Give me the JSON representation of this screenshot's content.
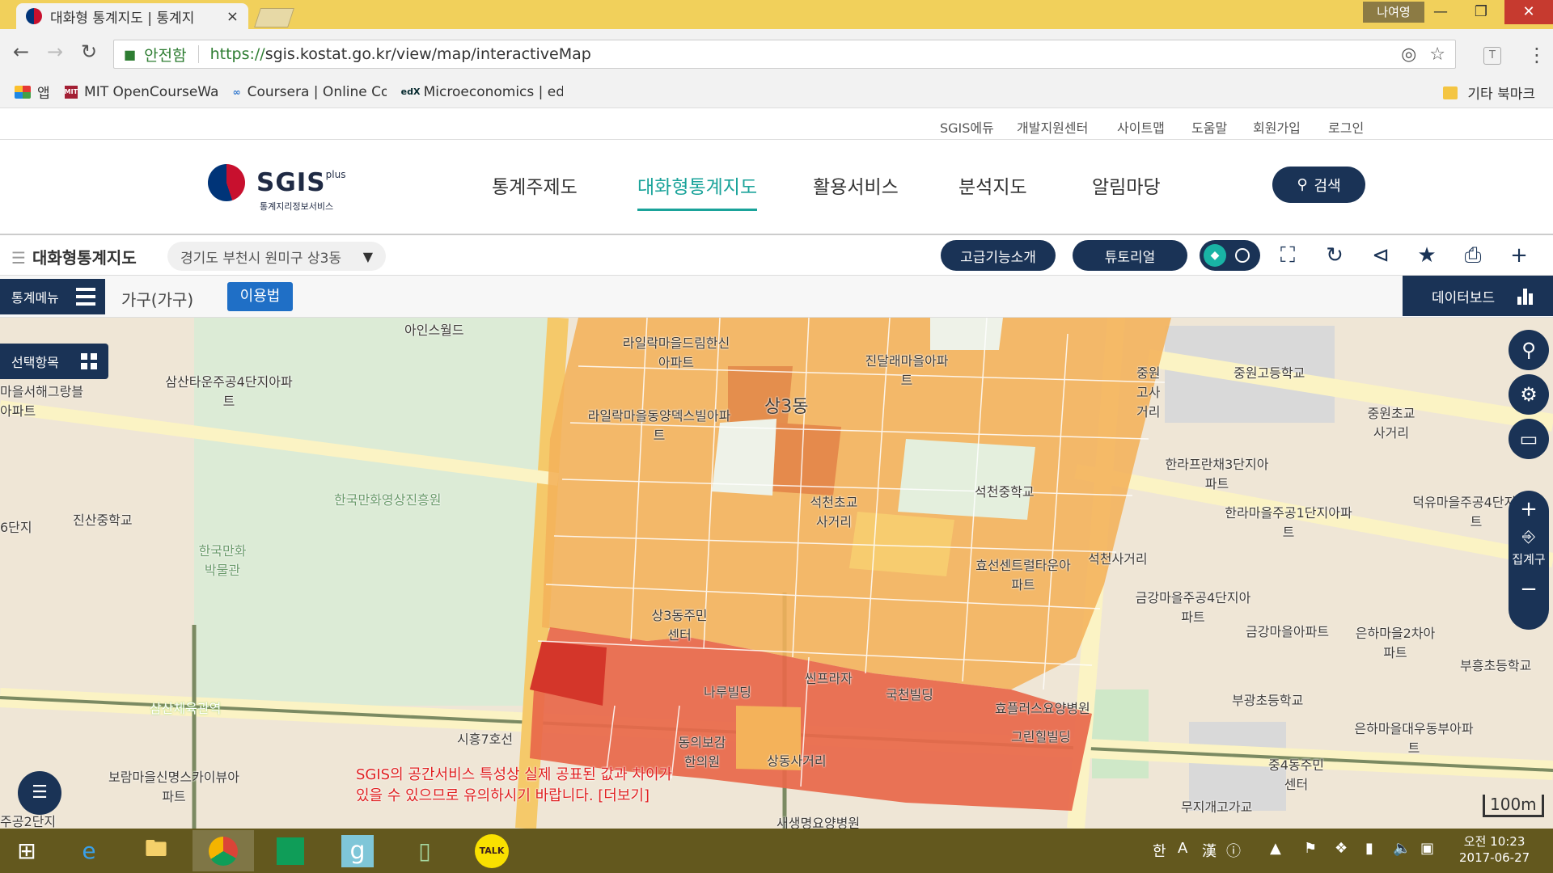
{
  "browser": {
    "tab_title": "대화형 통계지도 | 통계지",
    "tab_close": "×",
    "user": "나여영",
    "win_min": "—",
    "win_max": "❐",
    "win_close": "✕",
    "back": "←",
    "forward": "→",
    "reload": "↻",
    "secure_label": "안전함",
    "url_scheme": "https://",
    "url_rest": "sgis.kostat.go.kr/view/map/interactiveMap",
    "ext_label": "T",
    "bookmarks": [
      {
        "icon": "apps-icon",
        "label": "앱"
      },
      {
        "icon": "mit-icon",
        "label": "MIT OpenCourseWar"
      },
      {
        "icon": "coursera-icon",
        "label": "Coursera | Online Co"
      },
      {
        "icon": "edx-icon",
        "label": "Microeconomics | ed"
      }
    ],
    "other_bookmarks": "기타 북마크"
  },
  "site": {
    "util_links": [
      "SGIS에듀",
      "개발지원센터",
      "사이트맵",
      "도움말",
      "회원가입",
      "로그인"
    ],
    "logo_text": "SGIS",
    "logo_sup": "plus",
    "logo_sub": "통계지리정보서비스",
    "gnb": [
      "통계주제도",
      "대화형통계지도",
      "활용서비스",
      "분석지도",
      "알림마당"
    ],
    "search_label": "검색",
    "toolbar_title": "대화형통계지도",
    "region": "경기도 부천시 원미구 상3동",
    "advanced_btn": "고급기능소개",
    "tutorial_btn": "튜토리얼",
    "stat_menu": "통계메뉴",
    "sub_item": "가구(가구)",
    "usage_btn": "이용법",
    "databoard": "데이터보드",
    "select_items": "선택항목",
    "aggregate": "집계구",
    "notice_line1": "SGIS의 공간서비스 특성상 실제 공표된 값과 차이가",
    "notice_line2": "있을 수 있으므로 유의하시기 바랍니다. [더보기]",
    "scale": "100m"
  },
  "map_labels": [
    "아인스월드",
    "라일락마을드림한신아파트",
    "진달래마을아파트",
    "중원고사거리",
    "중원고등학교",
    "삼산타운주공4단지아파트",
    "마을서해그랑블아파트",
    "라일락마을동양덱스빌아파트",
    "상3동",
    "중원초교사거리",
    "석천초교사거리",
    "석천중학교",
    "한라프란채3단지아파트",
    "한라마을주공1단지아파트",
    "덕유마을주공4단지아파트",
    "한국만화영상진흥원",
    "진산중학교",
    "6단지",
    "한국만화박물관",
    "효선센트럴타운아파트",
    "금강마을주공4단지아파트",
    "금강마을아파트",
    "은하마을2차아파트",
    "부흥초등학교",
    "상3동주민센터",
    "씬프라자",
    "국천빌딩",
    "효플러스요양병원",
    "나루빌딩",
    "그린힐빌딩",
    "동의보감한의원",
    "부광초등학교",
    "중4동주민센터",
    "은하마을대우동부아파트",
    "삼산체육관역",
    "보람마을신명스카이뷰아파트",
    "주공2단지",
    "새생명요양병원",
    "무지개고가교",
    "시흥7호선",
    "석천사거리",
    "상동사거리"
  ],
  "taskbar": {
    "ime": "한",
    "clock_ampm": "오전 10:23",
    "clock_date": "2017-06-27",
    "talk": "TALK"
  }
}
